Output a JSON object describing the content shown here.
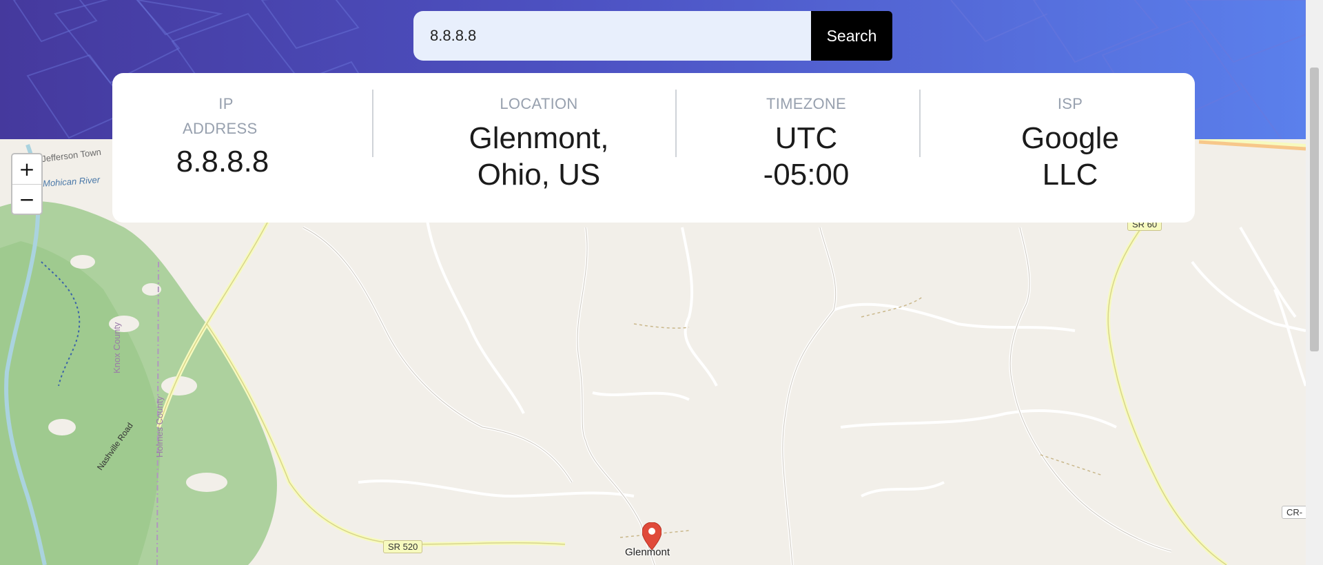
{
  "search": {
    "value": "8.8.8.8",
    "button_label": "Search"
  },
  "info": {
    "ip": {
      "label_line1": "IP",
      "label_line2": "ADDRESS",
      "value": "8.8.8.8"
    },
    "location": {
      "label": "LOCATION",
      "value_line1": "Glenmont,",
      "value_line2": "Ohio, US"
    },
    "timezone": {
      "label": "TIMEZONE",
      "value_line1": "UTC",
      "value_line2": "-05:00"
    },
    "isp": {
      "label": "ISP",
      "value_line1": "Google",
      "value_line2": "LLC"
    }
  },
  "map": {
    "zoom_in_label": "+",
    "zoom_out_label": "−",
    "labels": {
      "jefferson": "Jefferson Town",
      "mohican": "Mohican River",
      "knox": "Knox County",
      "holmes": "Holmes County",
      "nashville": "Nashville Road",
      "sr520": "SR 520",
      "sr60": "SR 60",
      "cr": "CR-",
      "glenmont": "Glenmont"
    },
    "marker_icon": "map-pin-icon",
    "marker_color": "#e04a3a"
  },
  "colors": {
    "header_start": "#45399d",
    "header_end": "#5b80ec",
    "accent": "#000000"
  }
}
